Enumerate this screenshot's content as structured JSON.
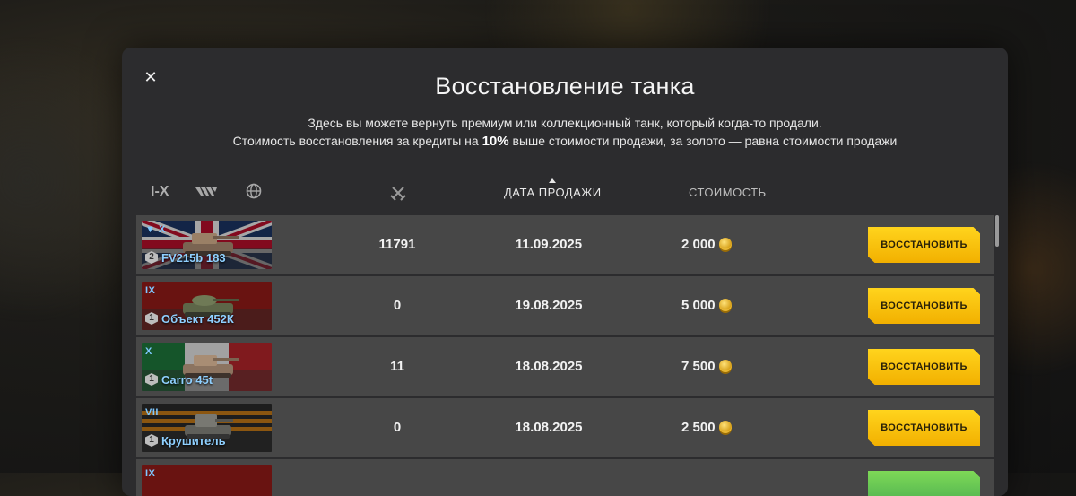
{
  "modal": {
    "title": "Восстановление танка",
    "desc_line1": "Здесь вы можете вернуть премиум или коллекционный танк, который когда-то продали.",
    "desc_line2_a": "Стоимость восстановления за кредиты на ",
    "desc_line2_bold": "10%",
    "desc_line2_b": " выше стоимости продажи, за золото — равна стоимости продажи",
    "close_icon": "close-icon"
  },
  "filters": {
    "tier": "I-X",
    "class_icon": "vehicle-class-icon",
    "nation_icon": "globe-icon"
  },
  "columns": {
    "battles_icon": "crossed-swords-icon",
    "date": "ДАТА ПРОДАЖИ",
    "cost": "СТОИМОСТЬ"
  },
  "rows": [
    {
      "tier": "▼ X",
      "mastery": "2",
      "name": "FV215b 183",
      "battles": "11791",
      "date": "11.09.2025",
      "cost": "2 000",
      "button": "ВОССТАНОВИТЬ",
      "flag": "uk"
    },
    {
      "tier": "IX",
      "mastery": "1",
      "name": "Объект 452К",
      "battles": "0",
      "date": "19.08.2025",
      "cost": "5 000",
      "button": "ВОССТАНОВИТЬ",
      "flag": "ussr"
    },
    {
      "tier": "X",
      "mastery": "1",
      "name": "Carro 45t",
      "battles": "11",
      "date": "18.08.2025",
      "cost": "7 500",
      "button": "ВОССТАНОВИТЬ",
      "flag": "italy"
    },
    {
      "tier": "VII",
      "mastery": "1",
      "name": "Крушитель",
      "battles": "0",
      "date": "18.08.2025",
      "cost": "2 500",
      "button": "ВОССТАНОВИТЬ",
      "flag": "ussr-ribbon"
    },
    {
      "tier": "IX",
      "mastery": "",
      "name": "",
      "battles": "",
      "date": "",
      "cost": "",
      "button": "",
      "flag": "ussr"
    }
  ],
  "colors": {
    "accent_button": "#f2b000",
    "tank_name": "#8fd0ff"
  }
}
